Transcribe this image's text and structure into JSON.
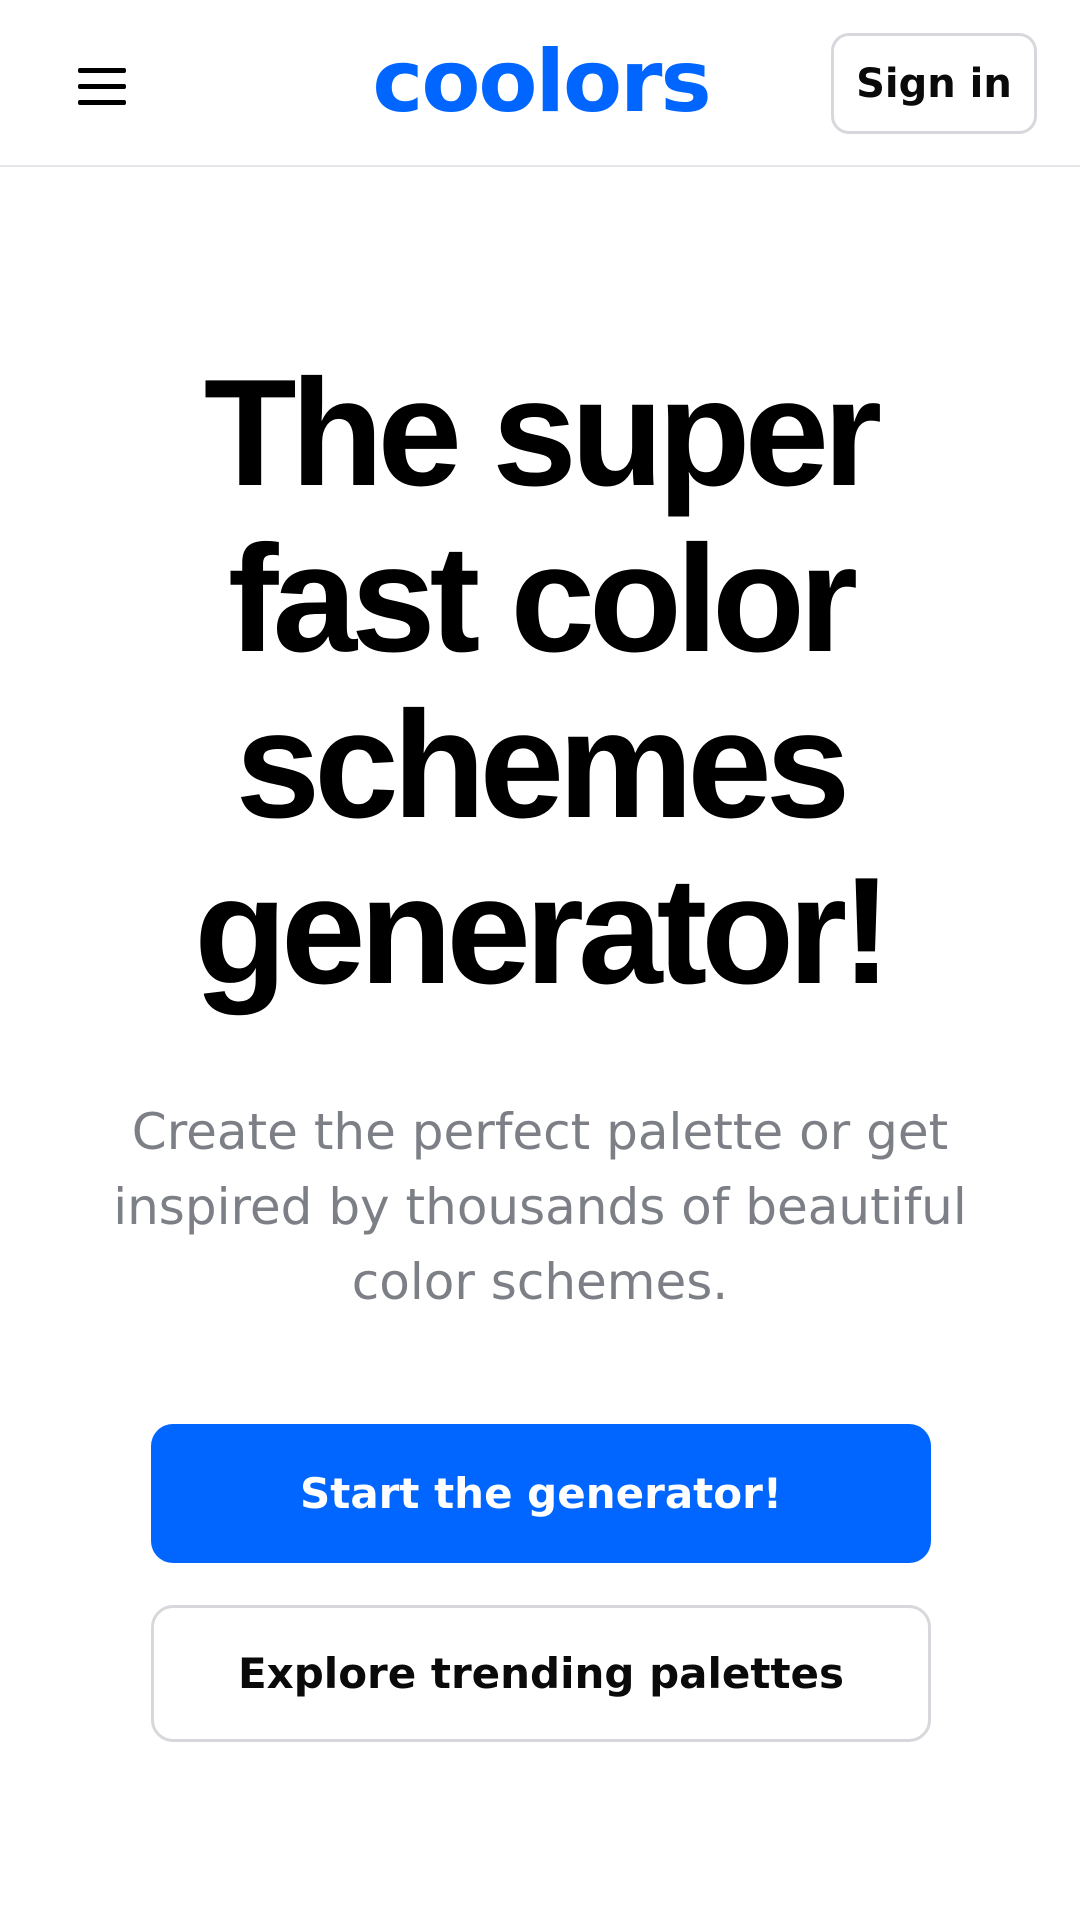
{
  "header": {
    "menu_icon": "hamburger-menu-icon",
    "logo_text": "coolors",
    "sign_in_label": "Sign in"
  },
  "hero": {
    "headline_lines": [
      "The super",
      "fast color",
      "schemes",
      "generator!"
    ],
    "subtitle_lines": [
      "Create the perfect palette or get",
      "inspired by thousands of beautiful",
      "color schemes."
    ],
    "primary_cta": "Start the generator!",
    "secondary_cta": "Explore trending palettes"
  },
  "colors": {
    "brand": "#0066ff",
    "headline": "#000000",
    "subtitle": "#7d7f86",
    "border": "#d7d8dc"
  }
}
